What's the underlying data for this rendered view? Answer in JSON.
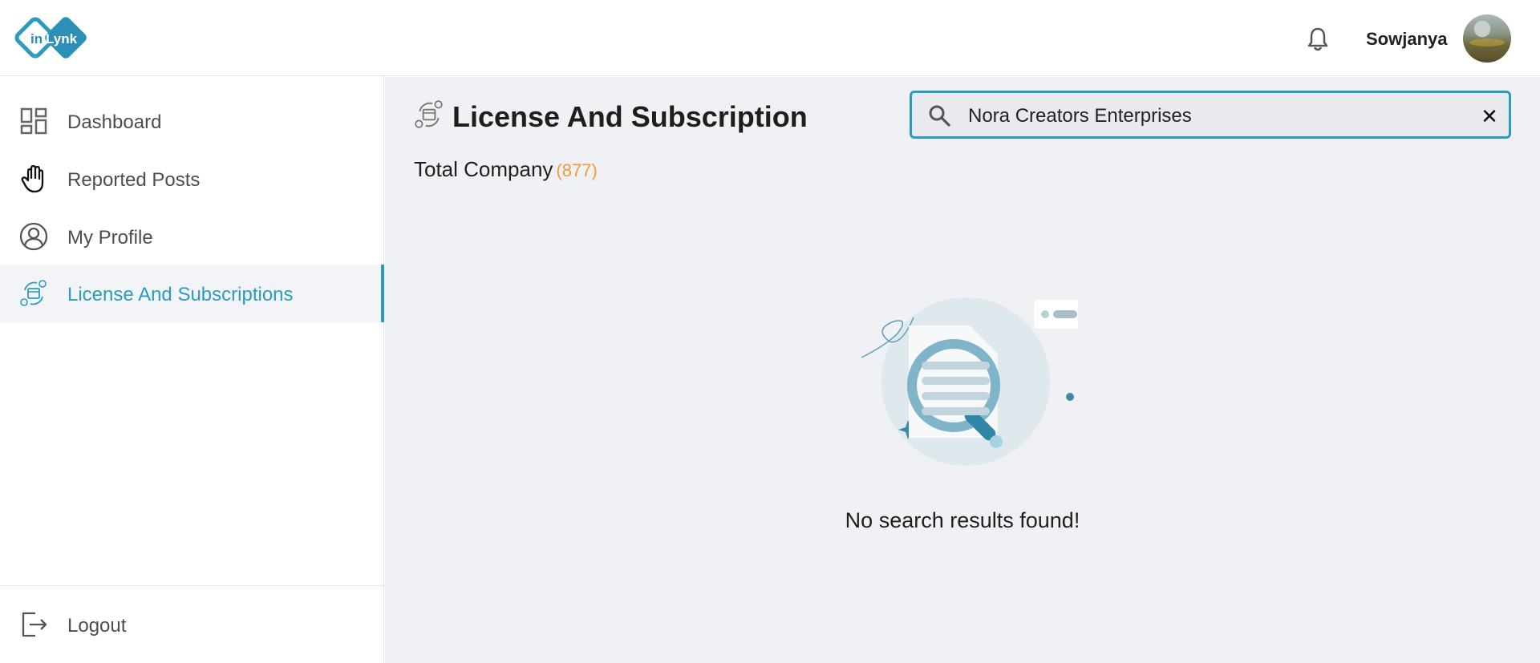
{
  "header": {
    "logo_text_in": "in",
    "logo_text_lynk": "Lynk",
    "username": "Sowjanya",
    "icons": {
      "notification": "bell-icon",
      "avatar": "user-avatar"
    }
  },
  "sidebar": {
    "items": [
      {
        "label": "Dashboard",
        "icon": "dashboard-icon",
        "active": false
      },
      {
        "label": "Reported Posts",
        "icon": "hand-icon",
        "active": false
      },
      {
        "label": "My Profile",
        "icon": "profile-icon",
        "active": false
      },
      {
        "label": "License And Subscriptions",
        "icon": "license-icon",
        "active": true
      }
    ],
    "logout_label": "Logout"
  },
  "main": {
    "title": "License And Subscription",
    "total_label": "Total Company",
    "total_count": "(877)",
    "search": {
      "value": "Nora Creators Enterprises",
      "clear_icon": "close-icon"
    },
    "empty_message": "No search results found!"
  },
  "colors": {
    "accent": "#2b9bbf",
    "count": "#f29a3a",
    "main_bg": "#f0f1f5"
  }
}
